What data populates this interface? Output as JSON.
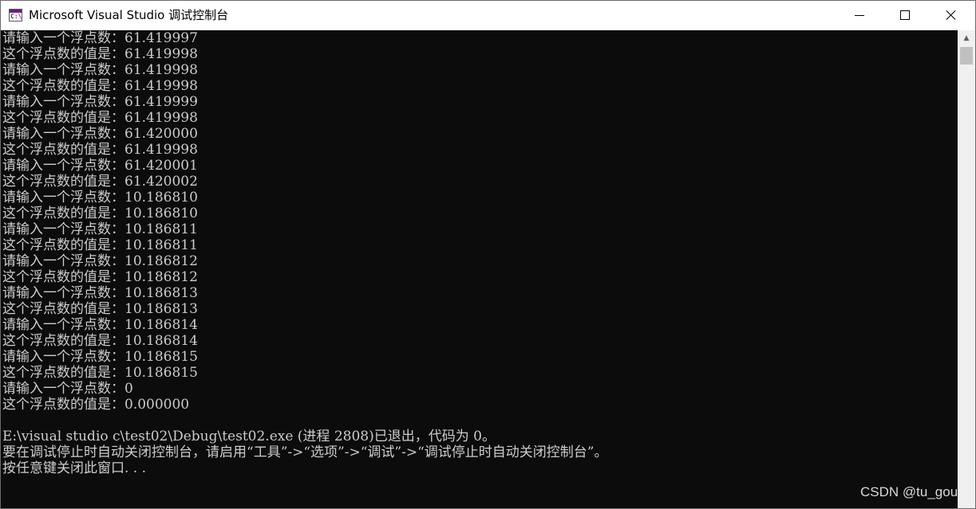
{
  "window": {
    "title": "Microsoft Visual Studio 调试控制台",
    "icon": "visual-studio-console-icon",
    "icon_glyph": "C:\\"
  },
  "controls": {
    "minimize": "minimize-icon",
    "maximize": "maximize-icon",
    "close": "close-icon"
  },
  "console": {
    "lines": [
      "请输入一个浮点数：61.419997",
      "这个浮点数的值是：61.419998",
      "请输入一个浮点数：61.419998",
      "这个浮点数的值是：61.419998",
      "请输入一个浮点数：61.419999",
      "这个浮点数的值是：61.419998",
      "请输入一个浮点数：61.420000",
      "这个浮点数的值是：61.419998",
      "请输入一个浮点数：61.420001",
      "这个浮点数的值是：61.420002",
      "请输入一个浮点数：10.186810",
      "这个浮点数的值是：10.186810",
      "请输入一个浮点数：10.186811",
      "这个浮点数的值是：10.186811",
      "请输入一个浮点数：10.186812",
      "这个浮点数的值是：10.186812",
      "请输入一个浮点数：10.186813",
      "这个浮点数的值是：10.186813",
      "请输入一个浮点数：10.186814",
      "这个浮点数的值是：10.186814",
      "请输入一个浮点数：10.186815",
      "这个浮点数的值是：10.186815",
      "请输入一个浮点数：0",
      "这个浮点数的值是：0.000000",
      "",
      "E:\\visual studio c\\test02\\Debug\\test02.exe (进程 2808)已退出，代码为 0。",
      "要在调试停止时自动关闭控制台，请启用“工具”->“选项”->“调试”->“调试停止时自动关闭控制台”。",
      "按任意键关闭此窗口. . ."
    ],
    "text_color": "#cccccc",
    "background_color": "#0c0c0c"
  },
  "watermark": "CSDN @tu_gou"
}
